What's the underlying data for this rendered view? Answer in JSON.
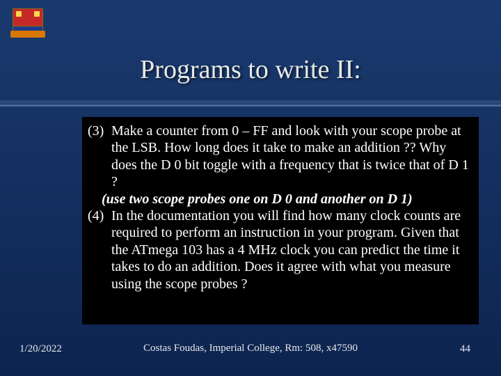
{
  "title": "Programs to write II:",
  "body": {
    "item3_num": "(3)",
    "item3_text": "Make a counter from 0 – FF and look with your scope probe at the LSB. How long does it take to make an addition ?? Why does the D 0 bit toggle with a frequency that is twice that of D 1 ?",
    "item3_hint": "(use two scope probes one on D 0 and another on D 1)",
    "item4_num": "(4)",
    "item4_text": "In the documentation you will find how many clock counts are required to perform an instruction in your program. Given that the ATmega 103 has a 4 MHz clock you can predict the time it takes to do an addition. Does it agree with what you measure using the scope probes ?"
  },
  "footer": {
    "date": "1/20/2022",
    "center_text": "Costas Foudas, Imperial College, Rm: 508, x47590",
    "page_number": "44"
  }
}
